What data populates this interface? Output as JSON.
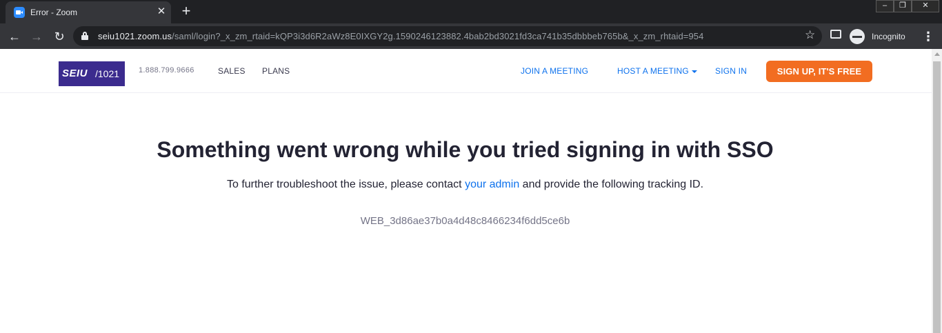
{
  "browser": {
    "tab_title": "Error - Zoom",
    "tab_close": "✕",
    "new_tab": "+",
    "url_host": "seiu1021.zoom.us",
    "url_path": "/saml/login?_x_zm_rtaid=kQP3i3d6R2aWz8E0IXGY2g.1590246123882.4bab2bd3021fd3ca741b35dbbbeb765b&_x_zm_rhtaid=954",
    "profile_label": "Incognito",
    "window_controls": {
      "minimize": "–",
      "restore": "❐",
      "close": "✕"
    }
  },
  "header": {
    "logo": {
      "primary": "SEIU",
      "secondary": "/1021"
    },
    "phone": "1.888.799.9666",
    "nav": {
      "sales": "SALES",
      "plans": "PLANS"
    },
    "join_meeting": "JOIN A MEETING",
    "host_meeting": "HOST A MEETING",
    "sign_in": "SIGN IN",
    "sign_up": "SIGN UP, IT'S FREE"
  },
  "error": {
    "title": "Something went wrong while you tried signing in with SSO",
    "message_before": "To further troubleshoot the issue, please contact ",
    "message_link": "your admin",
    "message_after": " and provide the following tracking ID.",
    "tracking_id": "WEB_3d86ae37b0a4d48c8466234f6dd5ce6b"
  },
  "colors": {
    "brand_blue": "#0e72ed",
    "signup_orange": "#f26d21",
    "logo_purple": "#3b2b8e"
  }
}
